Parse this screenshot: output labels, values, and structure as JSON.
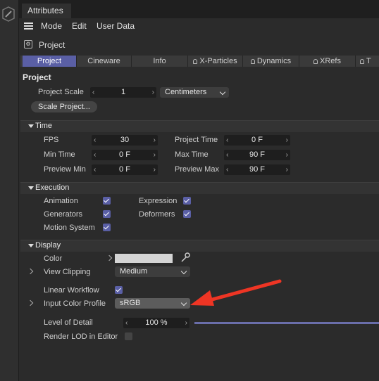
{
  "header": {
    "tab_label": "Attributes"
  },
  "menu": {
    "items": [
      "Mode",
      "Edit",
      "User Data"
    ]
  },
  "object": {
    "name": "Project"
  },
  "tabs": [
    {
      "label": "Project",
      "active": true,
      "lock": false
    },
    {
      "label": "Cineware",
      "active": false,
      "lock": false
    },
    {
      "label": "Info",
      "active": false,
      "lock": false
    },
    {
      "label": "X-Particles",
      "active": false,
      "lock": true
    },
    {
      "label": "Dynamics",
      "active": false,
      "lock": true
    },
    {
      "label": "XRefs",
      "active": false,
      "lock": true
    },
    {
      "label": "T",
      "active": false,
      "lock": true
    }
  ],
  "project": {
    "heading": "Project",
    "scale_label": "Project Scale",
    "scale_value": "1",
    "scale_unit": "Centimeters",
    "scale_button": "Scale Project..."
  },
  "time": {
    "title": "Time",
    "fps_label": "FPS",
    "fps_value": "30",
    "project_time_label": "Project Time",
    "project_time_value": "0 F",
    "min_time_label": "Min Time",
    "min_time_value": "0 F",
    "max_time_label": "Max Time",
    "max_time_value": "90 F",
    "preview_min_label": "Preview Min",
    "preview_min_value": "0 F",
    "preview_max_label": "Preview Max",
    "preview_max_value": "90 F"
  },
  "execution": {
    "title": "Execution",
    "animation_label": "Animation",
    "animation": true,
    "expression_label": "Expression",
    "expression": true,
    "generators_label": "Generators",
    "generators": true,
    "deformers_label": "Deformers",
    "deformers": true,
    "motion_label": "Motion System",
    "motion": true
  },
  "display": {
    "title": "Display",
    "color_label": "Color",
    "color_value": "#d4d4d4",
    "clipping_label": "View Clipping",
    "clipping_value": "Medium",
    "linear_label": "Linear Workflow",
    "linear": true,
    "input_profile_label": "Input Color Profile",
    "input_profile_value": "sRGB",
    "lod_label": "Level of Detail",
    "lod_value": "100 %",
    "render_lod_label": "Render LOD in Editor",
    "render_lod": false
  },
  "colors": {
    "accent": "#5a5fa5",
    "arrow": "#ee3524"
  }
}
